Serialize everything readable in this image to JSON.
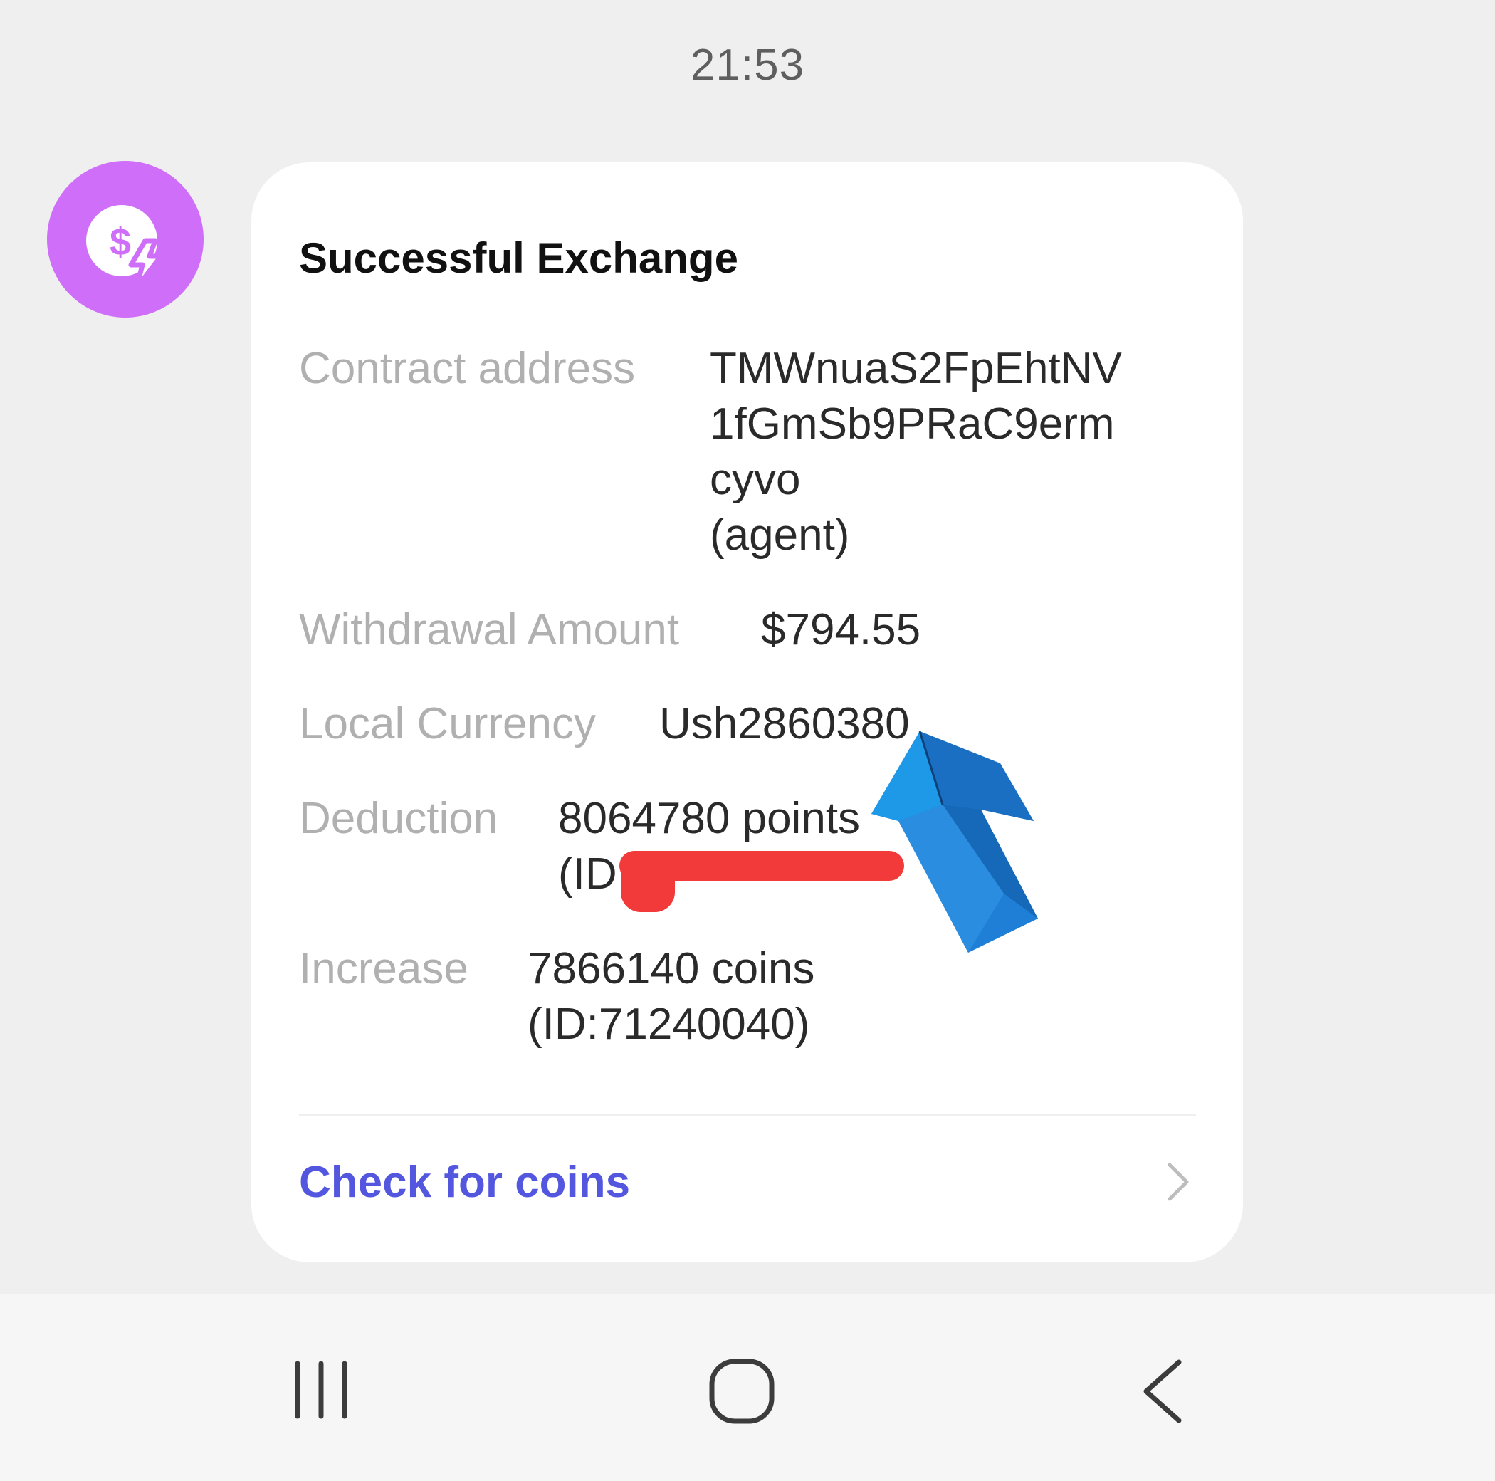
{
  "status_bar": {
    "time": "21:53"
  },
  "sender": {
    "avatar_icon": "dollar-lightning-icon",
    "avatar_color": "#cf6ef8"
  },
  "message": {
    "title": "Successful Exchange",
    "rows": [
      {
        "label": "Contract address",
        "value_lines": [
          "TMWnuaS2FpEhtNV",
          "1fGmSb9PRaC9erm",
          "cyvo",
          "(agent)"
        ]
      },
      {
        "label": "Withdrawal Amount",
        "value_lines": [
          "$794.55"
        ]
      },
      {
        "label": "Local Currency",
        "value_lines": [
          "Ush2860380"
        ]
      },
      {
        "label": "Deduction",
        "value_lines": [
          "8064780 points",
          "(ID:"
        ]
      },
      {
        "label": "Increase",
        "value_lines": [
          "7866140 coins",
          "(ID:71240040)"
        ]
      }
    ],
    "link_label": "Check for coins",
    "link_color": "#5356de"
  },
  "navbar": {
    "recents_icon": "recents-icon",
    "home_icon": "home-icon",
    "back_icon": "back-icon"
  },
  "overlay": {
    "arrow_icon": "blue-arrow-icon",
    "redaction_color": "#f23a3a"
  }
}
